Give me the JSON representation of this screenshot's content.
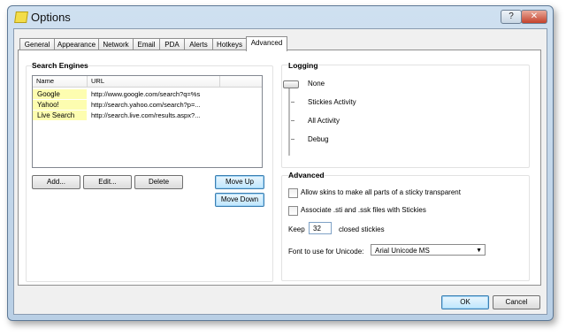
{
  "window": {
    "title": "Options",
    "help_label": "?",
    "close_label": "✕"
  },
  "tabs": [
    {
      "label": "General"
    },
    {
      "label": "Appearance"
    },
    {
      "label": "Network"
    },
    {
      "label": "Email"
    },
    {
      "label": "PDA"
    },
    {
      "label": "Alerts"
    },
    {
      "label": "Hotkeys"
    },
    {
      "label": "Advanced",
      "active": true
    }
  ],
  "search_engines": {
    "title": "Search Engines",
    "columns": [
      "Name",
      "URL"
    ],
    "rows": [
      {
        "name": "Google",
        "url": "http://www.google.com/search?q=%s"
      },
      {
        "name": "Yahoo!",
        "url": "http://search.yahoo.com/search?p=..."
      },
      {
        "name": "Live Search",
        "url": "http://search.live.com/results.aspx?..."
      }
    ],
    "buttons": {
      "add": "Add...",
      "edit": "Edit...",
      "delete": "Delete",
      "move_up": "Move Up",
      "move_down": "Move Down"
    }
  },
  "logging": {
    "title": "Logging",
    "levels": [
      "None",
      "Stickies Activity",
      "All Activity",
      "Debug"
    ],
    "selected": "None"
  },
  "advanced": {
    "title": "Advanced",
    "opt_transparent": "Allow skins to make all parts of a sticky transparent",
    "opt_associate": "Associate .sti and .ssk files with Stickies",
    "keep_label": "Keep",
    "keep_value": "32",
    "keep_suffix": "closed stickies",
    "font_label": "Font to use for Unicode:",
    "font_value": "Arial Unicode MS"
  },
  "footer": {
    "ok": "OK",
    "cancel": "Cancel"
  }
}
